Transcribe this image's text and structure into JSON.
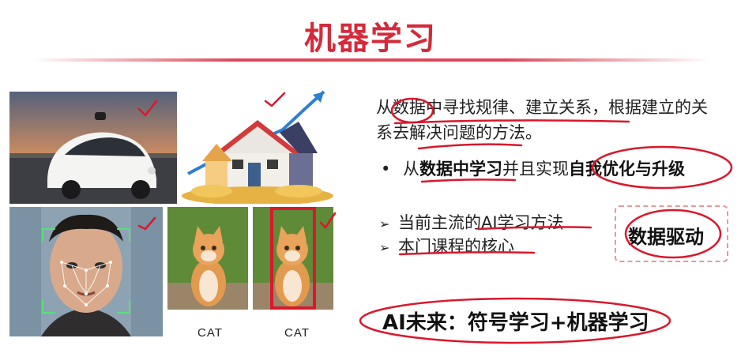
{
  "title": "机器学习",
  "images": {
    "car": "self-driving-car-photo",
    "house": "house-price-chart-illustration",
    "face": "face-recognition-photo",
    "cat_left": "cat-photo",
    "cat_right": "cat-photo-highlighted",
    "cat_left_label": "CAT",
    "cat_right_label": "CAT"
  },
  "description": "从数据中寻找规律、建立关系，根据建立的关系去解决问题的方法。",
  "bullet": {
    "marker": "•",
    "prefix": "从",
    "bold1": "数据中学习",
    "middle": "并且实现",
    "bold2": "自我优化与升级"
  },
  "arrow_items": [
    {
      "marker": "➢",
      "label": "当前主流的AI学习方法"
    },
    {
      "marker": "➢",
      "label": "本门课程的核心"
    }
  ],
  "highlight_box": "数据驱动",
  "future": "AI未来：符号学习+机器学习",
  "colors": {
    "title": "#d42a3a",
    "annotation": "#d9182c",
    "dashed_border": "#e29a9a"
  }
}
